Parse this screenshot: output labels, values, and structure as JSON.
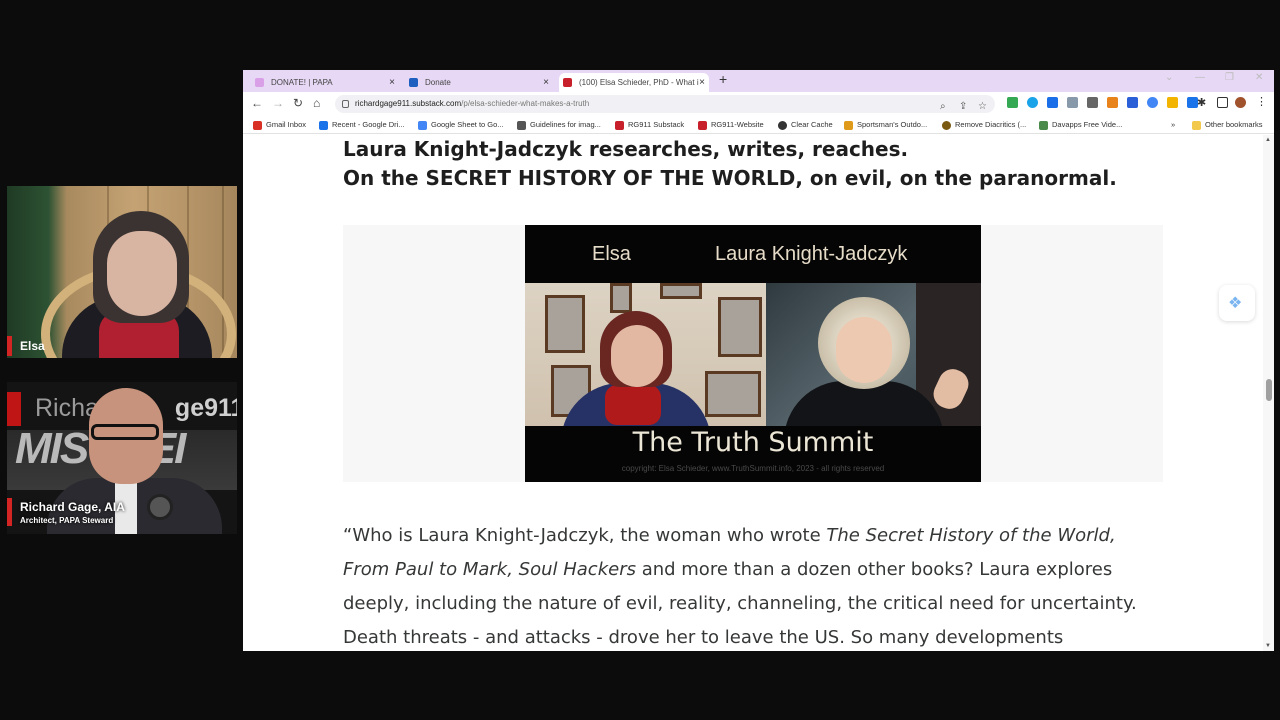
{
  "cams": {
    "guest_name": "Elsa",
    "host_logo_prefix": "Richa",
    "host_logo_suffix": "ge911:",
    "host_graffiti": "MISCHEI",
    "host_name": "Richard Gage, AIA",
    "host_role": "Architect, PAPA Steward"
  },
  "browser": {
    "tabs": [
      {
        "label": "DONATE! | PAPA",
        "icon_color": "#d9a0e8",
        "active": false
      },
      {
        "label": "Donate",
        "icon_color": "#1f5fbf",
        "active": false
      },
      {
        "label": "(100) Elsa Schieder, PhD - What i",
        "icon_color": "#c8202a",
        "active": true
      }
    ],
    "new_tab_symbol": "+",
    "close_symbol": "×",
    "url_host": "richardgage911.substack.com",
    "url_path": "/p/elsa-schieder-what-makes-a-truth",
    "bookmarks": [
      {
        "label": "Gmail Inbox",
        "color": "#d93025"
      },
      {
        "label": "Recent - Google Dri...",
        "color": "#1a73e8"
      },
      {
        "label": "Google Sheet to Go...",
        "color": "#4285f4"
      },
      {
        "label": "Guidelines for imag...",
        "color": "#555555"
      },
      {
        "label": "RG911 Substack",
        "color": "#c8202a"
      },
      {
        "label": "RG911-Website",
        "color": "#c8202a"
      },
      {
        "label": "Clear Cache",
        "color": "#333333"
      },
      {
        "label": "Sportsman's Outdo...",
        "color": "#e09a1a"
      },
      {
        "label": "Remove Diacritics (...",
        "color": "#7a5a10"
      },
      {
        "label": "Davapps Free Vide...",
        "color": "#4a8a4a"
      }
    ],
    "more_bookmarks": "»",
    "other_bookmarks": "Other bookmarks"
  },
  "article": {
    "headline_1": "Laura Knight-Jadczyk researches, writes, reaches.",
    "headline_2": "On the SECRET HISTORY OF THE WORLD, on evil, on the paranormal.",
    "thumbnail": {
      "name_left": "Elsa",
      "name_right": "Laura Knight-Jadczyk",
      "title": "The Truth Summit",
      "copyright": "copyright: Elsa Schieder, www.TruthSummit.info, 2023 - all rights reserved"
    },
    "p1_start": "“Who is Laura Knight-Jadczyk, the woman who wrote ",
    "p1_italic": "The Secret History of the World,",
    "p2_italic": "From Paul to Mark, Soul Hackers",
    "p2_end": " and more than a dozen other books? Laura explores",
    "p3": "deeply, including the nature of evil, reality, channeling, the critical need for uncertainty.",
    "p4": "Death threats - and attacks - drove her to leave the US. So many developments"
  }
}
